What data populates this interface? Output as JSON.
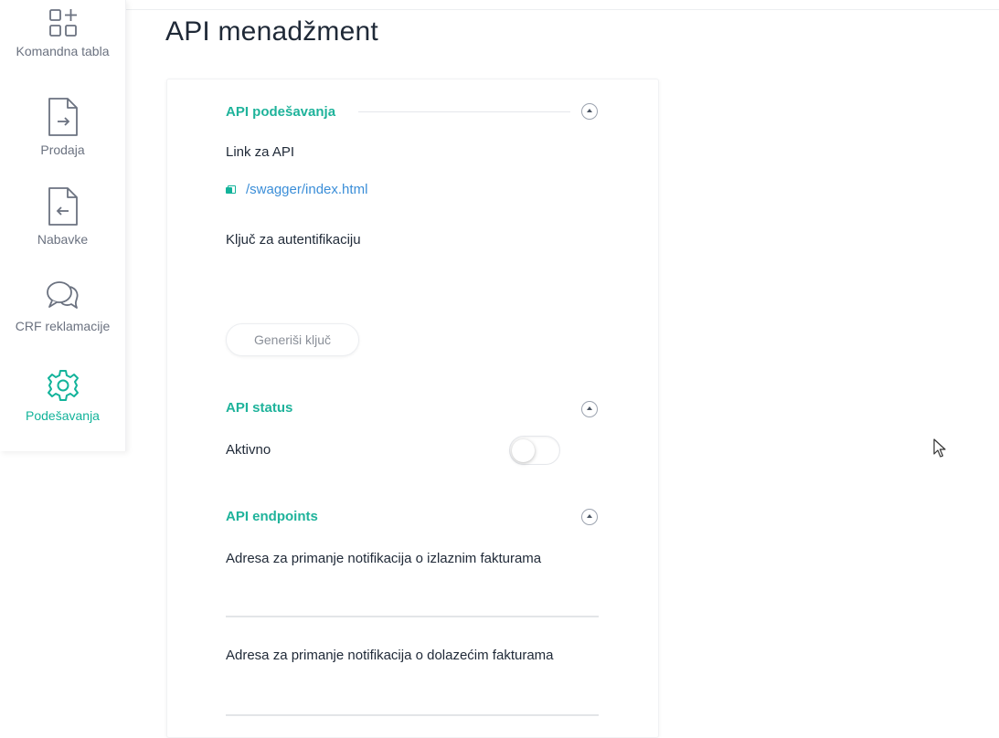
{
  "page": {
    "title": "API menadžment"
  },
  "sidebar": {
    "items": [
      {
        "label": "Komandna tabla",
        "icon": "dashboard-icon",
        "active": false
      },
      {
        "label": "Prodaja",
        "icon": "file-arrow-right-icon",
        "active": false
      },
      {
        "label": "Nabavke",
        "icon": "file-arrow-left-icon",
        "active": false
      },
      {
        "label": "CRF reklamacije",
        "icon": "chat-bubbles-icon",
        "active": false
      },
      {
        "label": "Podešavanja",
        "icon": "gear-icon",
        "active": true
      }
    ]
  },
  "api_settings": {
    "title": "API podešavanja",
    "link_label": "Link za API",
    "link_text": "/swagger/index.html",
    "auth_key_label": "Ključ za autentifikaciju",
    "generate_button": "Generiši ključ"
  },
  "api_status": {
    "title": "API status",
    "active_label": "Aktivno",
    "active": false
  },
  "api_endpoints": {
    "title": "API endpoints",
    "outgoing_label": "Adresa za primanje notifikacija o izlaznim fakturama",
    "outgoing_value": "",
    "incoming_label": "Adresa za primanje notifikacija o dolazećim fakturama",
    "incoming_value": ""
  },
  "colors": {
    "accent": "#1fb39b",
    "link": "#3b8ed8",
    "text": "#1f2937",
    "muted": "#6b7280"
  }
}
